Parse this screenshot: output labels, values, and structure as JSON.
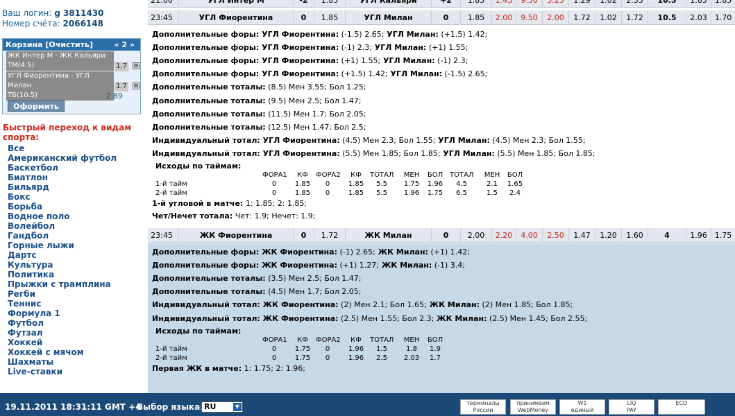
{
  "account": {
    "login_label": "Ваш логин:",
    "login_value": "g 3811430",
    "account_label": "Номер счёта:",
    "account_value": "2066148"
  },
  "cart": {
    "title": "Корзина [Очистить]",
    "nav": "« 2 »",
    "items": [
      {
        "line1": "ЖК Интер М - ЖК Кальяри",
        "line2": "ТМ(4.5)",
        "coef": "1.7"
      },
      {
        "line1": "УГЛ Фиорентина - УГЛ Милан",
        "line2": "ТБ(10.5)",
        "coef": "1.7"
      }
    ],
    "delete_symbol": "⊠",
    "total": "2.89",
    "checkout_label": "Оформить"
  },
  "quick_jump_title": "Быстрый переход к видам спорта:",
  "sports": [
    "Все",
    "Американский футбол",
    "Баскетбол",
    "Биатлон",
    "Бильярд",
    "Бокс",
    "Борьба",
    "Водное поло",
    "Волейбол",
    "Гандбол",
    "Горные лыжи",
    "Дартс",
    "Культура",
    "Политика",
    "Прыжки с трамплина",
    "Регби",
    "Теннис",
    "Формула 1",
    "Футбол",
    "Футзал",
    "Хоккей",
    "Хоккей с мячом",
    "Шахматы",
    "Live-ставки"
  ],
  "match_top_partial": {
    "time": "21:00",
    "home": "УГЛ Интер М",
    "h1": "-2",
    "c1": "1.85",
    "away": "УГЛ Кальяри",
    "h2": "+2",
    "c2": "1.85",
    "v1": "1.43",
    "v2": "9.50",
    "v3": "3.25",
    "v4": "1.29",
    "v5": "1.02",
    "v6": "2.35",
    "total": "10.5",
    "v7": "1.85",
    "v8": "1.85"
  },
  "match1": {
    "time": "23:45",
    "home": "УГЛ Фиорентина",
    "h1": "0",
    "c1": "1.85",
    "away": "УГЛ Милан",
    "h2": "0",
    "odds": [
      "1.85",
      "2.00",
      "9.50",
      "2.00",
      "1.72",
      "1.02",
      "1.72"
    ],
    "total": "10.5",
    "tu": "2.03",
    "to": "1.70"
  },
  "match1_details": {
    "lines": [
      {
        "label": "Дополнительные форы: УГЛ Фиорентина:",
        "text1": " (-1.5) 2.65;",
        "label2": " УГЛ Милан:",
        "text2": " (+1.5) 1.42;"
      },
      {
        "label": "Дополнительные форы: УГЛ Фиорентина:",
        "text1": " (-1) 2.3;",
        "label2": " УГЛ Милан:",
        "text2": " (+1) 1.55;"
      },
      {
        "label": "Дополнительные форы: УГЛ Фиорентина:",
        "text1": " (+1) 1.55;",
        "label2": " УГЛ Милан:",
        "text2": " (-1) 2.3;"
      },
      {
        "label": "Дополнительные форы: УГЛ Фиорентина:",
        "text1": " (+1.5) 1.42;",
        "label2": " УГЛ Милан:",
        "text2": " (-1.5) 2.65;"
      },
      {
        "label": "Дополнительные тоталы:",
        "text1": " (8.5) Мен 3.55; Бол 1.25;",
        "label2": "",
        "text2": ""
      },
      {
        "label": "Дополнительные тоталы:",
        "text1": " (9.5) Мен 2.5; Бол 1.47;",
        "label2": "",
        "text2": ""
      },
      {
        "label": "Дополнительные тоталы:",
        "text1": " (11.5) Мен 1.7; Бол 2.05;",
        "label2": "",
        "text2": ""
      },
      {
        "label": "Дополнительные тоталы:",
        "text1": " (12.5) Мен 1.47; Бол 2.5;",
        "label2": "",
        "text2": ""
      },
      {
        "label": "Индивидуальный тотал: УГЛ Фиорентина:",
        "text1": " (4.5) Мен 2.3; Бол 1.55;",
        "label2": " УГЛ Милан:",
        "text2": " (4.5) Мен 2.3; Бол 1.55;"
      },
      {
        "label": "Индивидуальный тотал: УГЛ Фиорентина:",
        "text1": " (5.5) Мен 1.85; Бол 1.85;",
        "label2": " УГЛ Милан:",
        "text2": " (5.5) Мен 1.85; Бол 1.85;"
      }
    ],
    "halves_title": "Исходы по таймам:",
    "halves_headers": [
      "ФОРА1",
      "КФ",
      "ФОРА2",
      "КФ",
      "ТОТАЛ",
      "МЕН",
      "БОЛ",
      "ТОТАЛ",
      "МЕН",
      "БОЛ"
    ],
    "halves_rows": [
      {
        "name": "1-й тайм",
        "vals": [
          "0",
          "1.85",
          "0",
          "1.85",
          "5.5",
          "1.75",
          "1.96",
          "4.5",
          "2.1",
          "1.65"
        ]
      },
      {
        "name": "2-й тайм",
        "vals": [
          "0",
          "1.85",
          "0",
          "1.85",
          "5.5",
          "1.96",
          "1.75",
          "6.5",
          "1.5",
          "2.4"
        ]
      }
    ],
    "corner": {
      "label": "1-й угловой в матче:",
      "text": " 1: 1.85; 2: 1.85;"
    },
    "oddeven": {
      "label": "Чет/Нечет тотала:",
      "text": " Чет: 1.9; Нечет: 1.9;"
    }
  },
  "match2": {
    "time": "23:45",
    "home": "ЖК Фиорентина",
    "h1": "0",
    "c1": "1.72",
    "away": "ЖК Милан",
    "h2": "0",
    "odds": [
      "2.00",
      "2.20",
      "4.00",
      "2.50",
      "1.47",
      "1.20",
      "1.60"
    ],
    "total": "4",
    "tu": "1.96",
    "to": "1.75"
  },
  "match2_details": {
    "lines": [
      {
        "label": "Дополнительные форы: ЖК Фиорентина:",
        "text1": " (-1) 2.65;",
        "label2": " ЖК Милан:",
        "text2": " (+1) 1.42;"
      },
      {
        "label": "Дополнительные форы: ЖК Фиорентина:",
        "text1": " (+1) 1.27;",
        "label2": " ЖК Милан:",
        "text2": " (-1) 3.4;"
      },
      {
        "label": "Дополнительные тоталы:",
        "text1": " (3.5) Мен 2.5; Бол 1.47;",
        "label2": "",
        "text2": ""
      },
      {
        "label": "Дополнительные тоталы:",
        "text1": " (4.5) Мен 1.7; Бол 2.05;",
        "label2": "",
        "text2": ""
      },
      {
        "label": "Индивидуальный тотал: ЖК Фиорентина:",
        "text1": " (2) Мен 2.1; Бол 1.65;",
        "label2": " ЖК Милан:",
        "text2": " (2) Мен 1.85; Бол 1.85;"
      },
      {
        "label": "Индивидуальный тотал: ЖК Фиорентина:",
        "text1": " (2.5) Мен 1.55; Бол 2.3;",
        "label2": " ЖК Милан:",
        "text2": " (2.5) Мен 1.45; Бол 2.55;"
      }
    ],
    "halves_title": "Исходы по таймам:",
    "halves_headers": [
      "ФОРА1",
      "КФ",
      "ФОРА2",
      "КФ",
      "ТОТАЛ",
      "МЕН",
      "БОЛ"
    ],
    "halves_rows": [
      {
        "name": "1-й тайм",
        "vals": [
          "0",
          "1.75",
          "0",
          "1.96",
          "1.5",
          "1.8",
          "1.9"
        ]
      },
      {
        "name": "2-й тайм",
        "vals": [
          "0",
          "1.75",
          "0",
          "1.96",
          "2.5",
          "2.03",
          "1.7"
        ]
      }
    ],
    "first": {
      "label": "Первая ЖК в матче:",
      "text": " 1: 1.75; 2: 1.96;"
    }
  },
  "footer": {
    "datetime": "19.11.2011  18:31:11  GMT +4",
    "lang_label": "Выбор языка:",
    "lang_value": "RU",
    "caret": "▼",
    "logos": [
      {
        "name": "terminals-logo",
        "line1": "терминалы",
        "line2": "России"
      },
      {
        "name": "webmoney-logo",
        "line1": "принимаем",
        "line2": "WebMoney"
      },
      {
        "name": "single-wallet-logo",
        "line1": "W1",
        "line2": "единый кошелек"
      },
      {
        "name": "liqpay-logo",
        "line1": "LIQ",
        "line2": "PAY"
      },
      {
        "name": "eco-logo",
        "line1": "ECO",
        "line2": ""
      }
    ]
  },
  "colors": {
    "accent": "#1c4a78",
    "red_odds": "#c8261c",
    "detail_blue": "#c6d9e9",
    "sidebar_link": "#1a4f8a",
    "quick_title": "#cc2a1a"
  }
}
